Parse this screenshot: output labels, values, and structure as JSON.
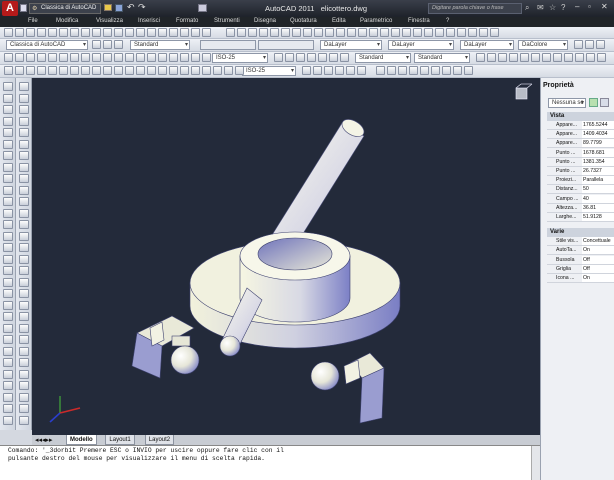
{
  "window": {
    "app_title": "AutoCAD 2011",
    "filename": "elicottero.dwg",
    "workspace": "Classica di AutoCAD",
    "search_placeholder": "Digitare parola chiave o frase"
  },
  "menu": [
    "File",
    "Modifica",
    "Visualizza",
    "Inserisci",
    "Formato",
    "Strumenti",
    "Disegna",
    "Quotatura",
    "Edita",
    "Parametrico",
    "Finestra",
    "?"
  ],
  "toolbar": {
    "workspace_combo": "Classica di AutoCAD",
    "text_style": "Standard",
    "dim_style": "ISO-25",
    "table_style": "Standard",
    "mleader_style": "Standard",
    "layer_color": "DaLayer",
    "linetype": "DaLayer",
    "lineweight": "DaLayer",
    "plot_style": "DaColore",
    "dim_style2": "ISO-25"
  },
  "properties": {
    "title": "Proprietà",
    "selection": "Nessuna se",
    "sections": [
      {
        "name": "Vista",
        "rows": [
          {
            "k": "Appare...",
            "v": "1765.5244"
          },
          {
            "k": "Appare...",
            "v": "1409.4034"
          },
          {
            "k": "Appare...",
            "v": "89.7799"
          },
          {
            "k": "Punto ...",
            "v": "1678.681"
          },
          {
            "k": "Punto ...",
            "v": "1381.354"
          },
          {
            "k": "Punto ...",
            "v": "26.7327"
          },
          {
            "k": "Proiezi...",
            "v": "Parallela"
          },
          {
            "k": "Distanz...",
            "v": "50"
          },
          {
            "k": "Campo ...",
            "v": "40"
          },
          {
            "k": "Altezza...",
            "v": "36.81"
          },
          {
            "k": "Larghe...",
            "v": "51.9128"
          }
        ]
      },
      {
        "name": "Varie",
        "rows": [
          {
            "k": "Stile vis...",
            "v": "Concettuale"
          },
          {
            "k": "AutoTa...",
            "v": "On"
          },
          {
            "k": "Bussola",
            "v": "Off"
          },
          {
            "k": "Griglia",
            "v": "Off"
          },
          {
            "k": "Icona ...",
            "v": "On"
          }
        ]
      }
    ]
  },
  "layout_tabs": [
    "Modello",
    "Layout1",
    "Layout2"
  ],
  "command_line": {
    "line1": "Comando: '_3dorbit Premere ESC o INVIO per uscire oppure fare clic con il",
    "line2": "pulsante destro del mouse per visualizzare il menu di scelta rapida."
  },
  "colors": {
    "viewport_bg": "#232a3a",
    "model_fill": "#f0f0d8",
    "model_shade": "#7f83c8"
  }
}
